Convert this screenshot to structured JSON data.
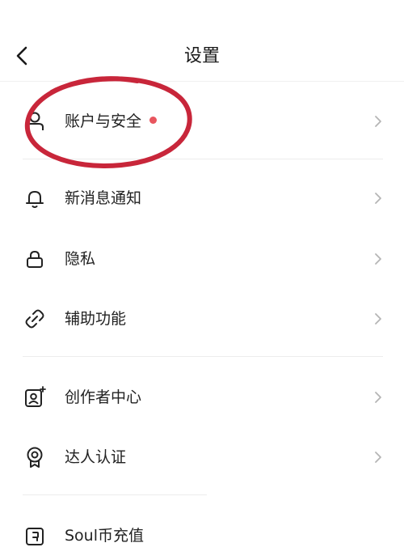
{
  "header": {
    "title": "设置"
  },
  "colors": {
    "badge": "#e8555e",
    "annotation": "#c8263a",
    "chevron": "#b5b5b5"
  },
  "menu": [
    {
      "label": "账户与安全",
      "icon": "user-icon",
      "has_badge": true
    },
    {
      "label": "新消息通知",
      "icon": "bell-icon"
    },
    {
      "label": "隐私",
      "icon": "lock-icon"
    },
    {
      "label": "辅助功能",
      "icon": "link-icon"
    },
    {
      "label": "创作者中心",
      "icon": "creator-icon"
    },
    {
      "label": "达人认证",
      "icon": "badge-icon"
    },
    {
      "label": "Soul币充值",
      "icon": "wallet-icon"
    }
  ]
}
